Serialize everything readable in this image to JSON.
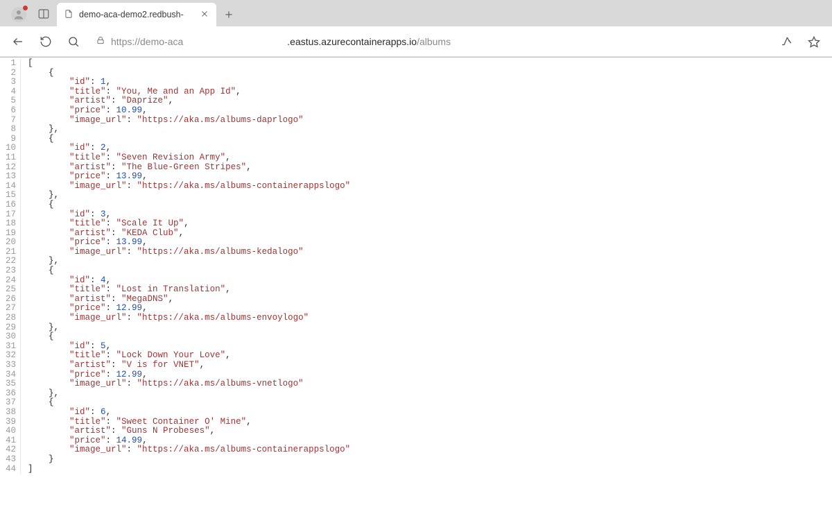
{
  "browser": {
    "tab_title": "demo-aca-demo2.redbush-",
    "url_prefix": "https://demo-aca",
    "url_middle": ".eastus.azurecontainerapps.io",
    "url_path": "/albums"
  },
  "json_response": [
    {
      "id": 1,
      "title": "You, Me and an App Id",
      "artist": "Daprize",
      "price": 10.99,
      "image_url": "https://aka.ms/albums-daprlogo"
    },
    {
      "id": 2,
      "title": "Seven Revision Army",
      "artist": "The Blue-Green Stripes",
      "price": 13.99,
      "image_url": "https://aka.ms/albums-containerappslogo"
    },
    {
      "id": 3,
      "title": "Scale It Up",
      "artist": "KEDA Club",
      "price": 13.99,
      "image_url": "https://aka.ms/albums-kedalogo"
    },
    {
      "id": 4,
      "title": "Lost in Translation",
      "artist": "MegaDNS",
      "price": 12.99,
      "image_url": "https://aka.ms/albums-envoylogo"
    },
    {
      "id": 5,
      "title": "Lock Down Your Love",
      "artist": "V is for VNET",
      "price": 12.99,
      "image_url": "https://aka.ms/albums-vnetlogo"
    },
    {
      "id": 6,
      "title": "Sweet Container O' Mine",
      "artist": "Guns N Probeses",
      "price": 14.99,
      "image_url": "https://aka.ms/albums-containerappslogo"
    }
  ],
  "colors": {
    "key_string": "#9c3535",
    "number": "#1a4fb5",
    "gutter": "#9a9a9a"
  }
}
